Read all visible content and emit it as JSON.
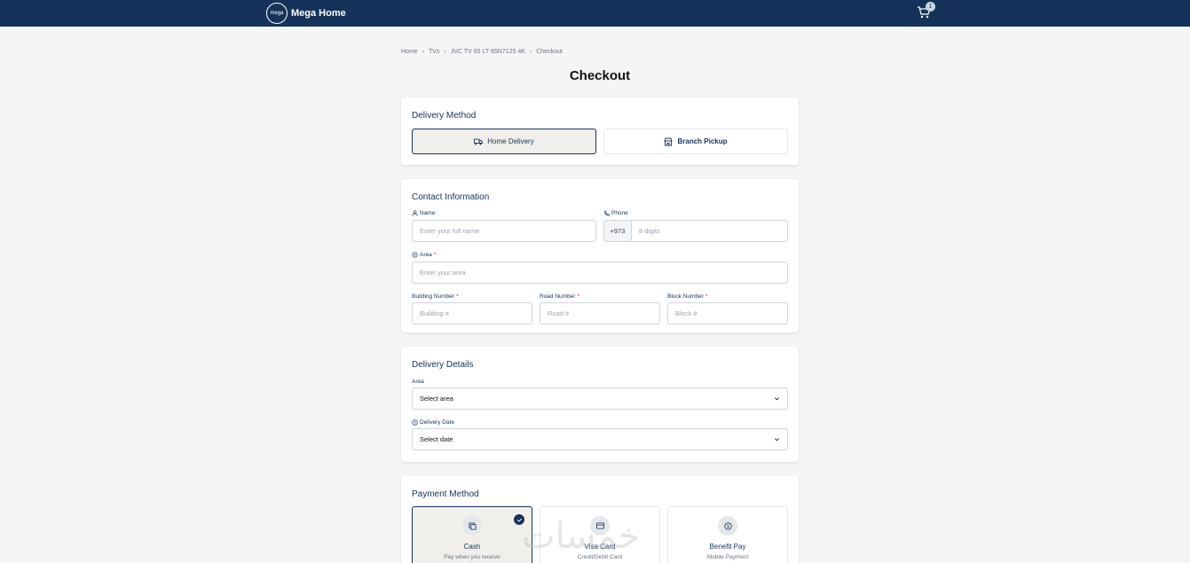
{
  "header": {
    "logo_mark": "mega",
    "brand": "Mega Home",
    "cart_count": "1",
    "background": "#15335a"
  },
  "breadcrumb": [
    "Home",
    "TVs",
    "JVC TV 65 LT 65N7125 4K",
    "Checkout"
  ],
  "page_title": "Checkout",
  "delivery_method": {
    "title": "Delivery Method",
    "options": [
      {
        "label": "Home Delivery",
        "icon": "truck-icon",
        "selected": true
      },
      {
        "label": "Branch Pickup",
        "icon": "store-icon",
        "selected": false
      }
    ]
  },
  "contact": {
    "title": "Contact Information",
    "name_label": "Name",
    "name_placeholder": "Enter your full name",
    "phone_label": "Phone",
    "phone_prefix": "+973",
    "phone_placeholder": "8 digits",
    "area_label": "Area",
    "area_placeholder": "Enter your area",
    "building_label": "Building Number",
    "building_placeholder": "Building #",
    "road_label": "Road Number",
    "road_placeholder": "Road #",
    "block_label": "Block Number",
    "block_placeholder": "Block #",
    "required_mark": "*"
  },
  "delivery_details": {
    "title": "Delivery Details",
    "area_label": "Area",
    "area_value": "Select area",
    "date_label": "Delivery Date",
    "date_value": "Select date"
  },
  "payment": {
    "title": "Payment Method",
    "options": [
      {
        "name": "Cash",
        "desc": "Pay when you receive",
        "icon": "cash-icon",
        "selected": true
      },
      {
        "name": "Visa Card",
        "desc": "Credit/Debit Card",
        "icon": "credit-card-icon",
        "selected": false
      },
      {
        "name": "Benefit Pay",
        "desc": "Mobile Payment",
        "icon": "dollar-coin-icon",
        "selected": false
      }
    ]
  },
  "watermark": "خمسات"
}
